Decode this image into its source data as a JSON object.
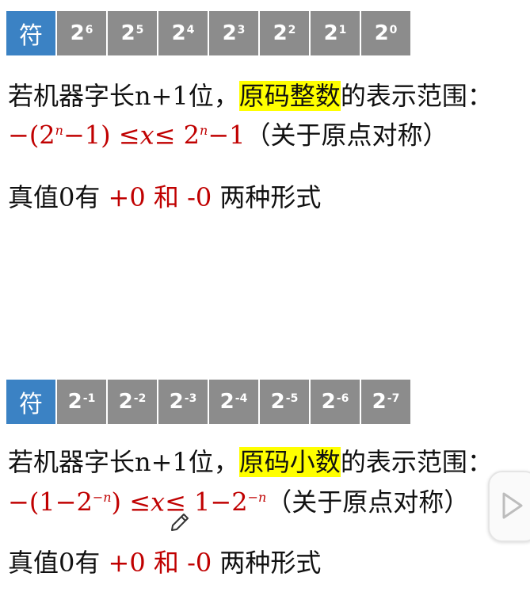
{
  "top_table": {
    "sign": "符",
    "bits": [
      {
        "base": "2",
        "exp": "6"
      },
      {
        "base": "2",
        "exp": "5"
      },
      {
        "base": "2",
        "exp": "4"
      },
      {
        "base": "2",
        "exp": "3"
      },
      {
        "base": "2",
        "exp": "2"
      },
      {
        "base": "2",
        "exp": "1"
      },
      {
        "base": "2",
        "exp": "0"
      }
    ]
  },
  "integer": {
    "prefix": "若机器字长n+1位，",
    "highlight": "原码整数",
    "suffix": "的表示范围：",
    "f1": "−(2",
    "f1_exp": "n",
    "f2": "−1) ",
    "f3": " ≤",
    "f4": "x",
    "f5": "≤",
    "f6": " 2",
    "f6_exp": "n",
    "f7": "−1",
    "note": "（关于原点对称）",
    "zero_prefix": "真值0有 ",
    "zero_plus": "+0 和 -0",
    "zero_suffix": " 两种形式"
  },
  "bottom_table": {
    "sign": "符",
    "bits": [
      {
        "base": "2",
        "exp": "-1"
      },
      {
        "base": "2",
        "exp": "-2"
      },
      {
        "base": "2",
        "exp": "-3"
      },
      {
        "base": "2",
        "exp": "-4"
      },
      {
        "base": "2",
        "exp": "-5"
      },
      {
        "base": "2",
        "exp": "-6"
      },
      {
        "base": "2",
        "exp": "-7"
      }
    ]
  },
  "fraction": {
    "prefix": "若机器字长n+1位，",
    "highlight": "原码小数",
    "suffix": "的表示范围：",
    "f1": "−(1−2",
    "f1_exp": "−n",
    "f2": ") ",
    "f3": " ≤",
    "f4": "x",
    "f5": "≤",
    "f6": " 1−2",
    "f6_exp": "−n",
    "note": "（关于原点对称）",
    "zero_prefix": "真值0有 ",
    "zero_plus": "+0 和 -0",
    "zero_suffix": " 两种形式"
  },
  "icons": {
    "pencil": "pencil-icon",
    "play": "play-icon"
  }
}
